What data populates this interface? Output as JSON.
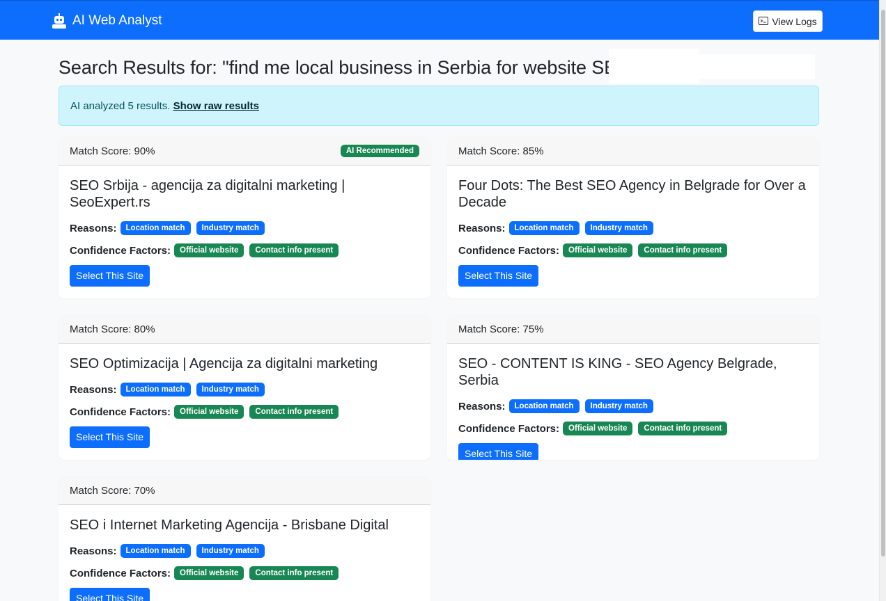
{
  "navbar": {
    "brand": "AI Web Analyst",
    "brand_icon": "robot-icon",
    "logs_button": "View Logs",
    "logs_icon": "terminal-icon",
    "color": "#0d6efd"
  },
  "page": {
    "title": "Search Results for: \"find me local business in Serbia for website SEO\""
  },
  "alert": {
    "text": "AI analyzed 5 results. ",
    "link": "Show raw results"
  },
  "results": [
    {
      "score": "Match Score: 90%",
      "badge": "AI Recommended",
      "title": "SEO Srbija - agencija za digitalni marketing | SeoExpert.rs",
      "reasons_label": "Reasons:",
      "reasons": [
        "Location match",
        "Industry match"
      ],
      "confidence_label": "Confidence Factors:",
      "confidence": [
        "Official website",
        "Contact info present"
      ],
      "button": "Select This Site"
    },
    {
      "score": "Match Score: 85%",
      "title": "Four Dots: The Best SEO Agency in Belgrade for Over a Decade",
      "reasons_label": "Reasons:",
      "reasons": [
        "Location match",
        "Industry match"
      ],
      "confidence_label": "Confidence Factors:",
      "confidence": [
        "Official website",
        "Contact info present"
      ],
      "button": "Select This Site"
    },
    {
      "score": "Match Score: 80%",
      "title": "SEO Optimizacija | Agencija za digitalni marketing",
      "reasons_label": "Reasons:",
      "reasons": [
        "Location match",
        "Industry match"
      ],
      "confidence_label": "Confidence Factors:",
      "confidence": [
        "Official website",
        "Contact info present"
      ],
      "button": "Select This Site"
    },
    {
      "score": "Match Score: 75%",
      "title": "SEO - CONTENT IS KING - SEO Agency Belgrade, Serbia",
      "reasons_label": "Reasons:",
      "reasons": [
        "Location match",
        "Industry match"
      ],
      "confidence_label": "Confidence Factors:",
      "confidence": [
        "Official website",
        "Contact info present"
      ],
      "button": "Select This Site"
    },
    {
      "score": "Match Score: 70%",
      "title": "SEO i Internet Marketing Agencija - Brisbane Digital",
      "reasons_label": "Reasons:",
      "reasons": [
        "Location match",
        "Industry match"
      ],
      "confidence_label": "Confidence Factors:",
      "confidence": [
        "Official website",
        "Contact info present"
      ],
      "button": "Select This Site"
    }
  ]
}
